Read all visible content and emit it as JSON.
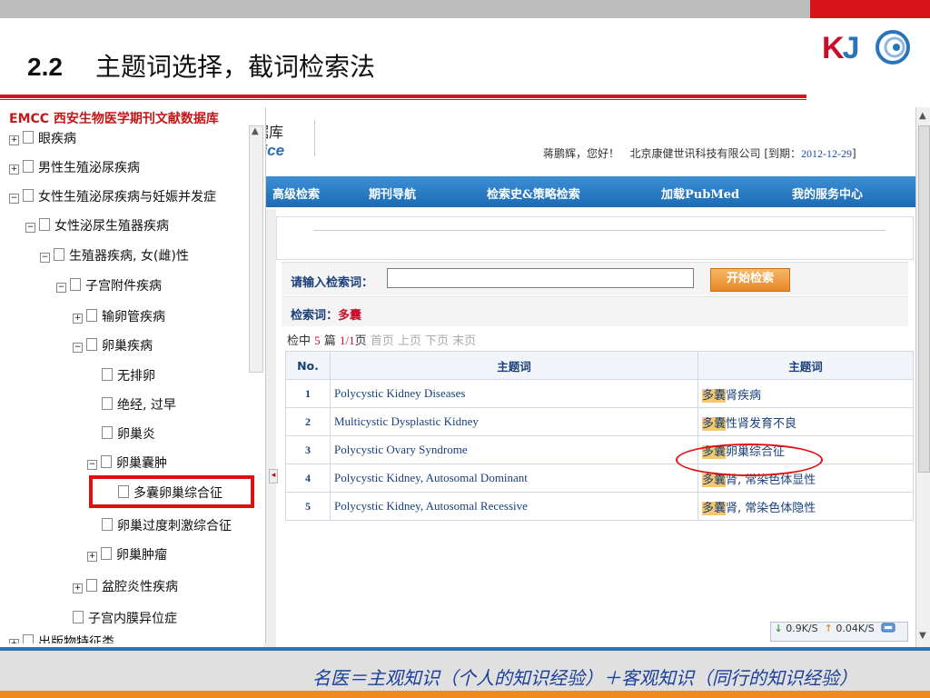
{
  "slide": {
    "number": "2.2",
    "title": "主题词选择，截词检索法",
    "logo_k": "K",
    "logo_j": "J",
    "footer": "名医＝主观知识（个人的知识经验）＋客观知识（同行的知识经验）"
  },
  "site": {
    "header_title": "据库",
    "header_sub": "vice",
    "user_greeting": "蒋鹏辉，您好！",
    "company": "北京康健世讯科技有限公司",
    "expiry_label": "[到期：",
    "expiry_date": "2012-12-29",
    "expiry_close": "]"
  },
  "nav": {
    "items": [
      "高级检索",
      "期刊导航",
      "检索史&策略检索",
      "加载PubMed",
      "我的服务中心"
    ]
  },
  "search": {
    "label": "请输入检索词：",
    "value": "",
    "button": "开始检索",
    "term_label": "检索词：",
    "term_value": "多囊"
  },
  "pager": {
    "prefix": "检中",
    "count": "5",
    "unit": "篇",
    "page": "1/1",
    "page_suffix": "页",
    "links": "首页 上页 下页 末页"
  },
  "table": {
    "headers": [
      "No.",
      "主题词",
      "主题词"
    ],
    "rows": [
      {
        "no": "1",
        "en": "Polycystic Kidney Diseases",
        "cn_hl": "多囊",
        "cn_rest": "肾疾病"
      },
      {
        "no": "2",
        "en": "Multicystic Dysplastic Kidney",
        "cn_hl": "多囊",
        "cn_rest": "性肾发育不良"
      },
      {
        "no": "3",
        "en": "Polycystic Ovary Syndrome",
        "cn_hl": "多囊",
        "cn_rest": "卵巢综合征"
      },
      {
        "no": "4",
        "en": "Polycystic Kidney, Autosomal Dominant",
        "cn_hl": "多囊",
        "cn_rest": "肾, 常染色体显性"
      },
      {
        "no": "5",
        "en": "Polycystic Kidney, Autosomal Recessive",
        "cn_hl": "多囊",
        "cn_rest": "肾, 常染色体隐性"
      }
    ]
  },
  "netspeed": {
    "down": "↓",
    "down_val": "0.9K/S",
    "up": "↑",
    "up_val": "0.04K/S"
  },
  "tree": {
    "overlap_text": "EMCC 西安生物医学期刊文献数据库",
    "items": [
      "眼疾病",
      "男性生殖泌尿疾病",
      "女性生殖泌尿疾病与妊娠并发症",
      "女性泌尿生殖器疾病",
      "生殖器疾病, 女(雌)性",
      "子宫附件疾病",
      "输卵管疾病",
      "卵巢疾病",
      "无排卵",
      "绝经, 过早",
      "卵巢炎",
      "卵巢囊肿",
      "多囊卵巢综合征",
      "卵巢过度刺激综合征",
      "卵巢肿瘤",
      "盆腔炎性疾病",
      "子宫内膜异位症",
      "出版物特征类"
    ]
  }
}
